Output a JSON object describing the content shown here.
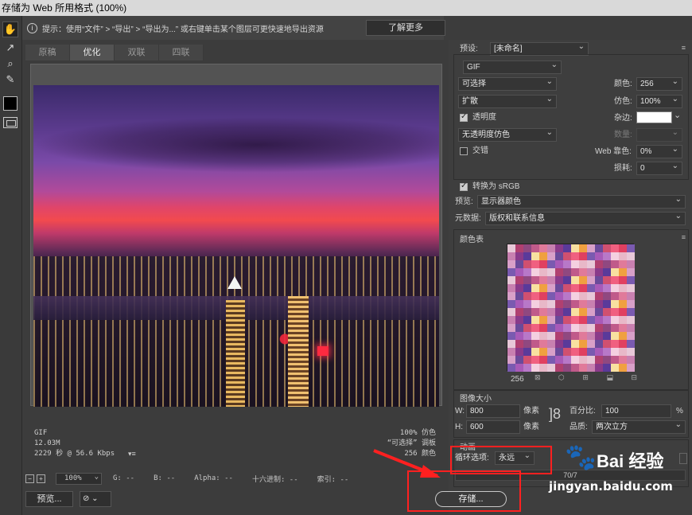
{
  "window": {
    "title": "存储为 Web 所用格式 (100%)"
  },
  "toolbox": {
    "tools": [
      {
        "name": "hand-tool",
        "glyph": "✋"
      },
      {
        "name": "slice-select-tool",
        "glyph": "↗"
      },
      {
        "name": "zoom-tool",
        "glyph": "⌕"
      },
      {
        "name": "eyedropper-tool",
        "glyph": "✎"
      }
    ],
    "foreground_color": "#000000"
  },
  "hint": {
    "info_glyph": "i",
    "text": "提示：使用“文件” > “导出” > “导出为...” 或右键单击某个图层可更快速地导出资源",
    "learn_more": "了解更多"
  },
  "tabs": [
    {
      "label": "原稿",
      "active": false
    },
    {
      "label": "优化",
      "active": true
    },
    {
      "label": "双联",
      "active": false
    },
    {
      "label": "四联",
      "active": false
    }
  ],
  "image_info": {
    "format": "GIF",
    "size": "12.03M",
    "time": "2229 秒 @ 56.6 Kbps",
    "dither": "100% 仿色",
    "palette": "“可选择” 调板",
    "colors": "256 颜色",
    "menu_glyph": "▾≡"
  },
  "statusbar": {
    "zoom": "100%",
    "g": "G: --",
    "b": "B: --",
    "alpha": "Alpha: --",
    "hex": "十六进制: --",
    "index": "索引: --"
  },
  "bottom": {
    "preview": "预览...",
    "browser_glyph": "⊘ ⌄",
    "save": "存储..."
  },
  "right_panel": {
    "preset_label": "预设:",
    "preset_value": "[未命名]",
    "format": "GIF",
    "reduction": "可选择",
    "dither_algo": "扩散",
    "transparency_label": "透明度",
    "transparency_checked": true,
    "trans_dither": "无透明度仿色",
    "interlaced_label": "交错",
    "interlaced_checked": false,
    "colors_label": "颜色:",
    "colors_value": "256",
    "dither_label": "仿色:",
    "dither_value": "100%",
    "matte_label": "杂边:",
    "matte_color": "#ffffff",
    "amount_label": "数量:",
    "web_snap_label": "Web 靠色:",
    "web_snap_value": "0%",
    "lossy_label": "损耗:",
    "lossy_value": "0",
    "convert_srgb_label": "转换为 sRGB",
    "convert_srgb_checked": true,
    "preview_label": "预览:",
    "preview_value": "显示器颜色",
    "metadata_label": "元数据:",
    "metadata_value": "版权和联系信息",
    "color_table_title": "颜色表",
    "color_count": "256",
    "color_table_icons": "⊠ ⬡ ⊞ ⬓ ⊟",
    "image_size_title": "图像大小",
    "w_label": "W:",
    "w_value": "800",
    "h_label": "H:",
    "h_value": "600",
    "px_unit": "像素",
    "percent_label": "百分比:",
    "percent_value": "100",
    "percent_unit": "%",
    "quality_label": "品质:",
    "quality_value": "两次立方",
    "animation_title": "动画",
    "loop_label": "循环选项:",
    "loop_value": "永远",
    "frame_counter": "70/7",
    "panel_menu_glyph": "≡"
  },
  "watermark": {
    "paw": "🐾",
    "text": "Bai 经验",
    "url": "jingyan.baidu.com"
  },
  "colors": {
    "annotation_red": "#ff2020"
  }
}
